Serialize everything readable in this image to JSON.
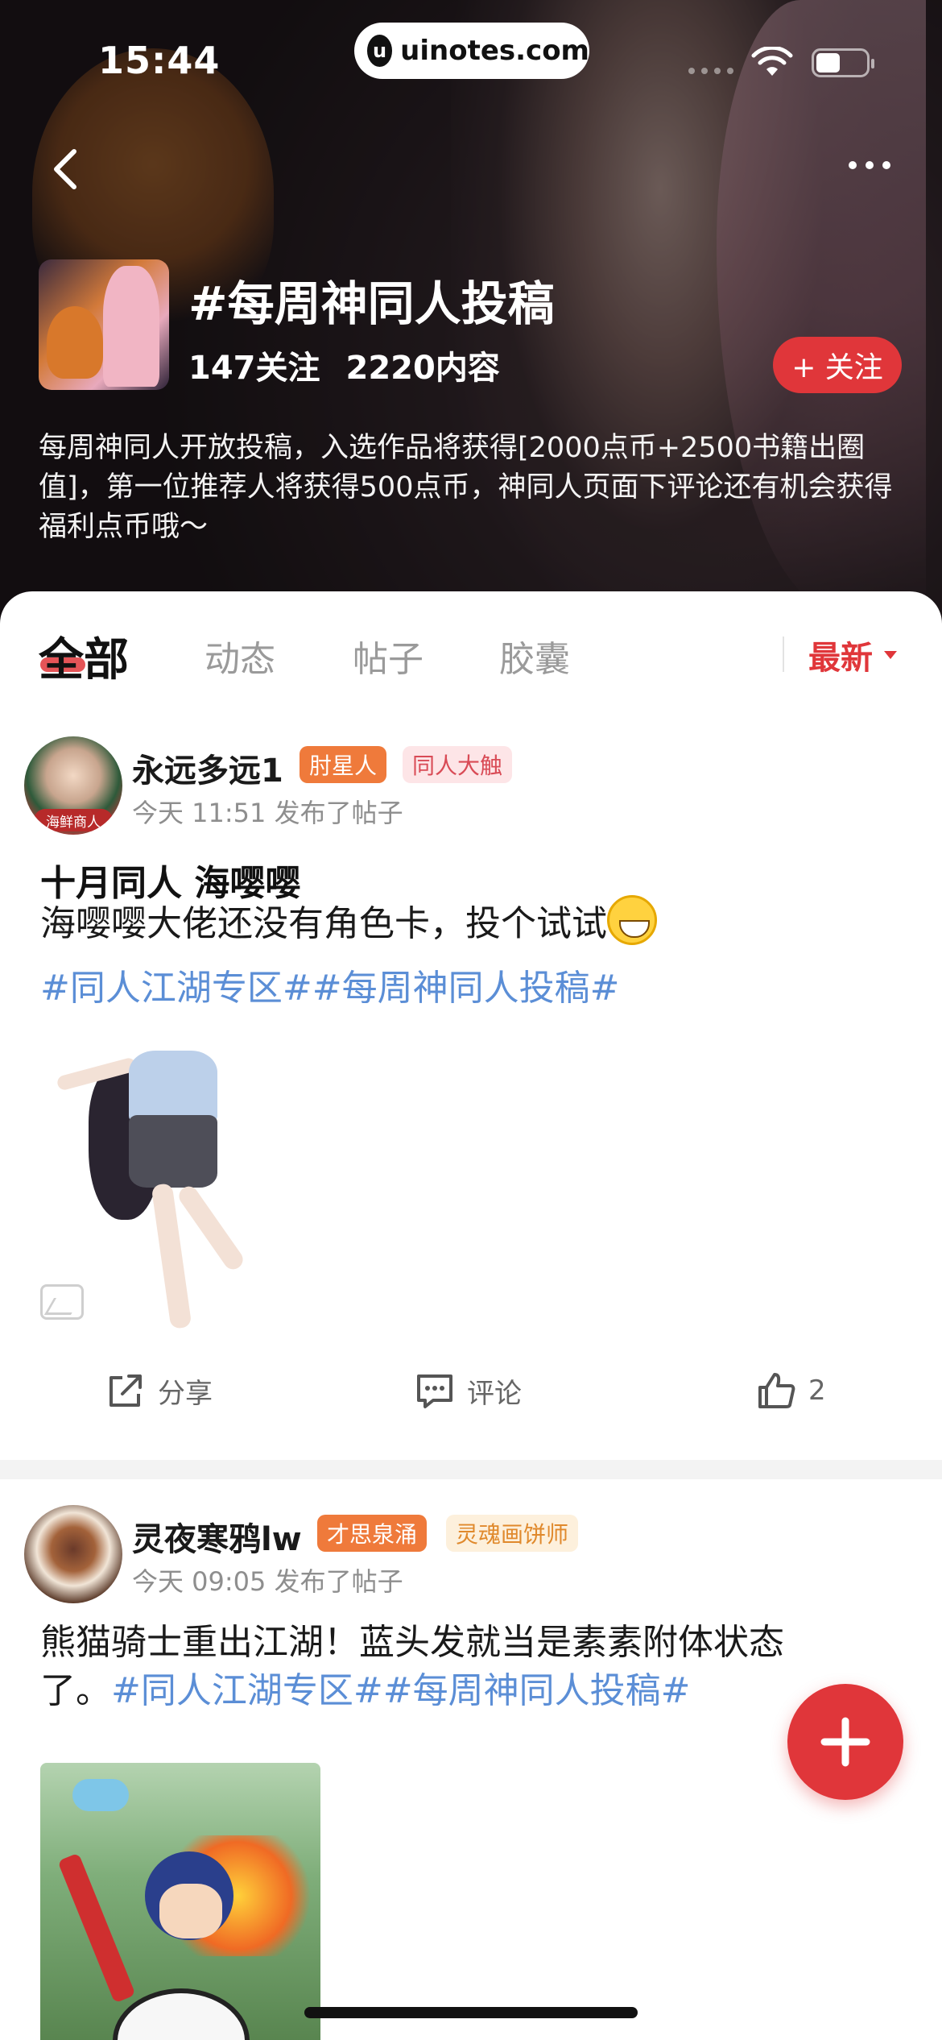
{
  "status_bar": {
    "time": "15:44",
    "watermark": "uinotes.com",
    "watermark_logo": "u"
  },
  "topic": {
    "title": "#每周神同人投稿",
    "followers": "147关注",
    "contents": "2220内容",
    "follow_label": "+ 关注",
    "description": "每周神同人开放投稿，入选作品将获得[2000点币+2500书籍出圈值]，第一位推荐人将获得500点币，神同人页面下评论还有机会获得福利点币哦～"
  },
  "tabs": [
    {
      "label": "全部",
      "active": true
    },
    {
      "label": "动态",
      "active": false
    },
    {
      "label": "帖子",
      "active": false
    },
    {
      "label": "胶囊",
      "active": false
    }
  ],
  "sort_label": "最新",
  "posts": [
    {
      "author": "永远多远1",
      "avatar_tag": "海鲜商人",
      "badges": [
        "肘星人",
        "同人大触"
      ],
      "meta": "今天 11:51 发布了帖子",
      "title": "十月同人 海嘤嘤",
      "text": "海嘤嘤大佬还没有角色卡，投个试试",
      "tags": "#同人江湖专区##每周神同人投稿#",
      "share_label": "分享",
      "comment_label": "评论",
      "like_count": "2"
    },
    {
      "author": "灵夜寒鸦lw",
      "badges": [
        "才思泉涌",
        "灵魂画饼师"
      ],
      "meta": "今天 09:05 发布了帖子",
      "text_line1": "熊猫骑士重出江湖！蓝头发就当是素素附体状态",
      "text_line2": "了。",
      "tags": "#同人江湖专区##每周神同人投稿#"
    }
  ],
  "colors": {
    "accent": "#e0363a",
    "tag_blue": "#5b8ed6",
    "badge_orange": "#ef7a3b"
  },
  "icons": [
    "back-icon",
    "more-icon",
    "wifi-icon",
    "battery-icon",
    "share-icon",
    "comment-icon",
    "thumbs-up-icon",
    "image-icon",
    "plus-icon"
  ]
}
